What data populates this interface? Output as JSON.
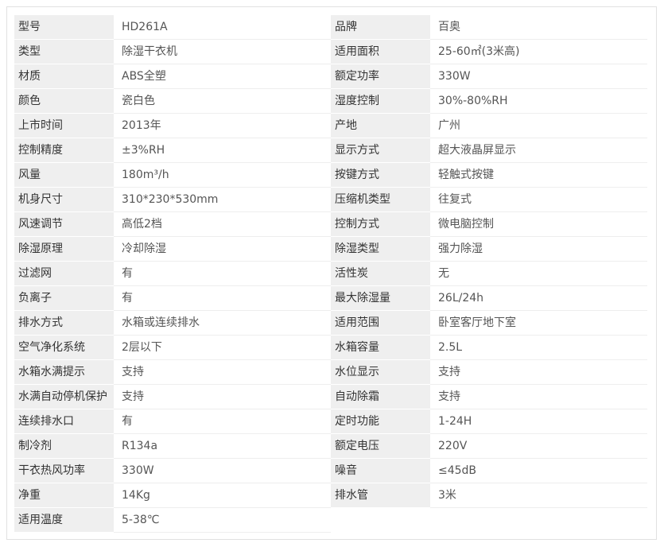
{
  "specs": {
    "left": [
      {
        "label": "型号",
        "value": "HD261A"
      },
      {
        "label": "类型",
        "value": "除湿干衣机"
      },
      {
        "label": "材质",
        "value": "ABS全塑"
      },
      {
        "label": "颜色",
        "value": "瓷白色"
      },
      {
        "label": "上市时间",
        "value": "2013年"
      },
      {
        "label": "控制精度",
        "value": "±3%RH"
      },
      {
        "label": "风量",
        "value": "180m³/h"
      },
      {
        "label": "机身尺寸",
        "value": "310*230*530mm"
      },
      {
        "label": "风速调节",
        "value": "高低2档"
      },
      {
        "label": "除湿原理",
        "value": "冷却除湿"
      },
      {
        "label": "过滤网",
        "value": "有"
      },
      {
        "label": "负离子",
        "value": "有"
      },
      {
        "label": "排水方式",
        "value": "水箱或连续排水"
      },
      {
        "label": "空气净化系统",
        "value": "2层以下"
      },
      {
        "label": "水箱水满提示",
        "value": "支持"
      },
      {
        "label": "水满自动停机保护",
        "value": "支持"
      },
      {
        "label": "连续排水口",
        "value": "有"
      },
      {
        "label": "制冷剂",
        "value": "R134a"
      },
      {
        "label": "干衣热风功率",
        "value": "330W"
      },
      {
        "label": "净重",
        "value": "14Kg"
      },
      {
        "label": "适用温度",
        "value": "5-38℃"
      }
    ],
    "right": [
      {
        "label": "品牌",
        "value": "百奥"
      },
      {
        "label": "适用面积",
        "value": "25-60㎡(3米高)"
      },
      {
        "label": "额定功率",
        "value": "330W"
      },
      {
        "label": "湿度控制",
        "value": "30%-80%RH"
      },
      {
        "label": "产地",
        "value": "广州"
      },
      {
        "label": "显示方式",
        "value": "超大液晶屏显示"
      },
      {
        "label": "按键方式",
        "value": "轻触式按键"
      },
      {
        "label": "压缩机类型",
        "value": "往复式"
      },
      {
        "label": "控制方式",
        "value": "微电脑控制"
      },
      {
        "label": "除湿类型",
        "value": "强力除湿"
      },
      {
        "label": "活性炭",
        "value": "无"
      },
      {
        "label": "最大除湿量",
        "value": "26L/24h"
      },
      {
        "label": "适用范围",
        "value": "卧室客厅地下室"
      },
      {
        "label": "水箱容量",
        "value": "2.5L"
      },
      {
        "label": "水位显示",
        "value": "支持"
      },
      {
        "label": "自动除霜",
        "value": "支持"
      },
      {
        "label": "定时功能",
        "value": "1-24H"
      },
      {
        "label": "额定电压",
        "value": "220V"
      },
      {
        "label": "噪音",
        "value": "≤45dB"
      },
      {
        "label": "排水管",
        "value": "3米"
      }
    ]
  }
}
